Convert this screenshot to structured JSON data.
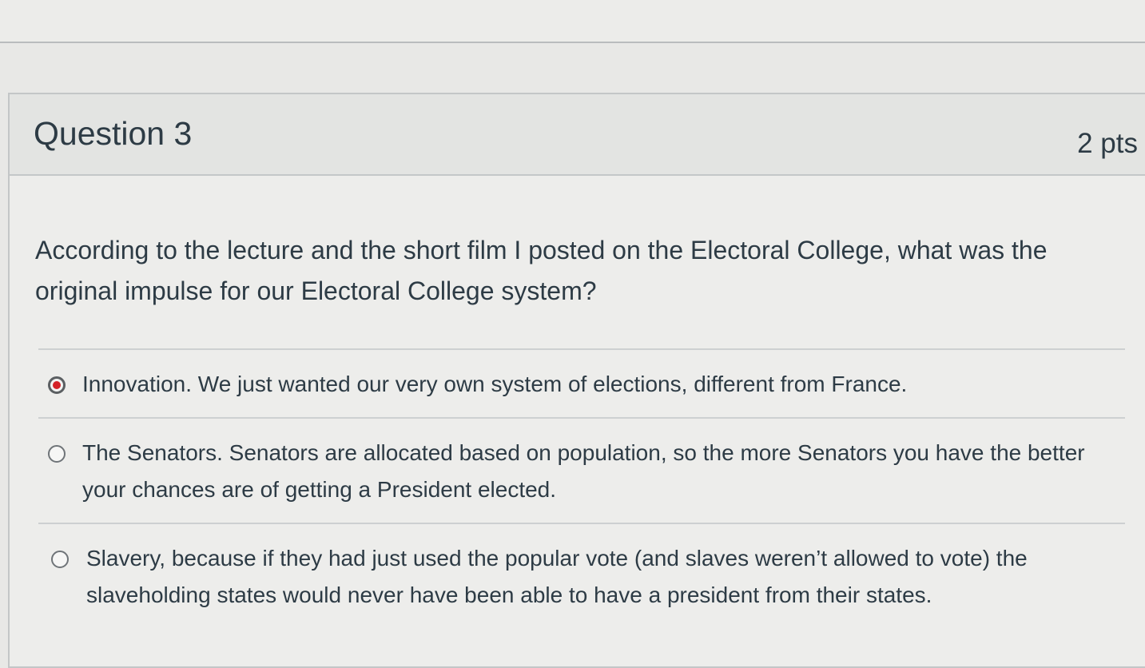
{
  "question": {
    "title": "Question 3",
    "points": "2 pts",
    "text": "According to the lecture and the short film I posted on the Electoral College, what was the original impulse for our Electoral College system?"
  },
  "answers": [
    {
      "label": "Innovation. We just wanted our very own system of elections, different from France.",
      "selected": true
    },
    {
      "label": "The Senators. Senators are allocated based on population, so the more Senators you have the better your chances are of getting a President elected.",
      "selected": false
    },
    {
      "label": "Slavery, because if they had just used the popular vote (and slaves weren’t allowed to vote) the slaveholding states would never have been able to have a president from their states.",
      "selected": false
    }
  ],
  "colors": {
    "text": "#2d3b45",
    "radio_selected": "#d42127",
    "background": "#ededeb"
  }
}
